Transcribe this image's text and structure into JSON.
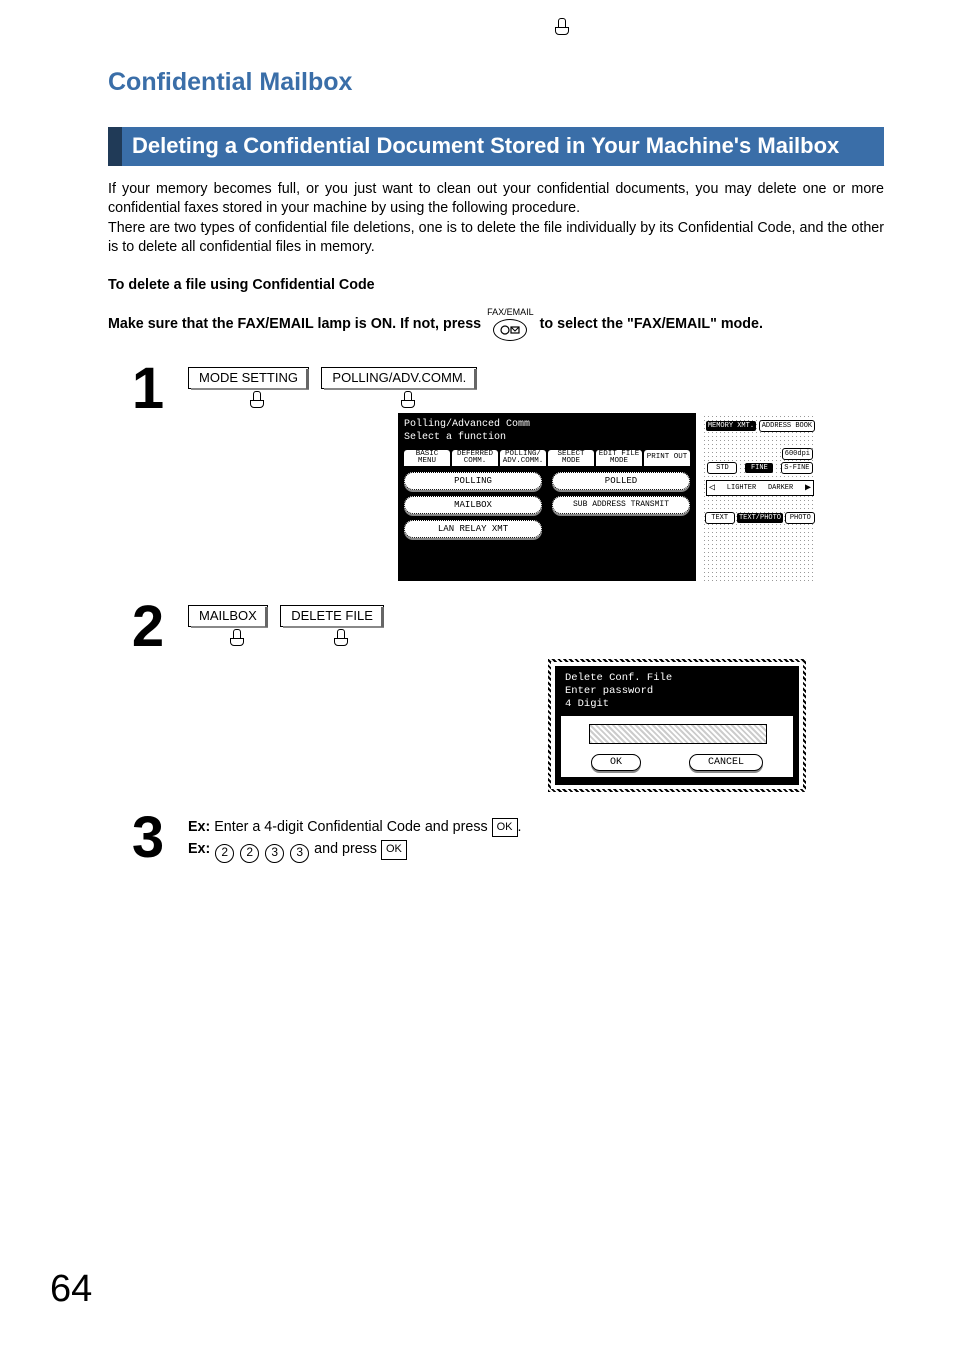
{
  "page_title": "Confidential Mailbox",
  "section_title": "Deleting a Confidential Document Stored in Your Machine's Mailbox",
  "intro": "If your memory becomes full, or you just want to clean out your confidential documents, you may delete one or more confidential faxes stored in your machine by using the following procedure.\nThere are two types of confidential file deletions, one is to delete the file individually by its Confidential Code, and the other is to delete all confidential files in memory.",
  "sub_heading": "To delete a file using Confidential Code",
  "make_sure": {
    "part1": "Make sure that the FAX/EMAIL lamp is ON.  If not, press ",
    "icon_label": "FAX/EMAIL",
    "part2": " to select the \"FAX/EMAIL\" mode."
  },
  "steps": {
    "s1": {
      "num": "1",
      "btn1": "MODE SETTING",
      "btn2": "POLLING/ADV.COMM."
    },
    "s2": {
      "num": "2",
      "btn1": "MAILBOX",
      "btn2": "DELETE FILE"
    },
    "s3": {
      "num": "3",
      "ex_label": "Ex:",
      "line1_text": "Enter a 4-digit Confidential Code and press ",
      "ok": "OK",
      "line2_nums": [
        "2",
        "2",
        "3",
        "3"
      ],
      "line2_mid": " and press "
    }
  },
  "lcd": {
    "header1": "Polling/Advanced Comm",
    "header2": "Select a function",
    "tabs": [
      "BASIC MENU",
      "DEFERRED COMM.",
      "POLLING/ ADV.COMM.",
      "SELECT MODE",
      "EDIT FILE MODE",
      "PRINT OUT"
    ],
    "funcs": [
      "POLLING",
      "POLLED",
      "MAILBOX",
      "SUB ADDRESS TRANSMIT",
      "LAN RELAY XMT"
    ]
  },
  "side_panel": {
    "top_row": [
      "MEMORY XMT.",
      "ADDRESS BOOK"
    ],
    "dpi": "600dpi",
    "row2": [
      "STD",
      "FINE",
      "S-FINE"
    ],
    "lighter": "LIGHTER",
    "darker": "DARKER",
    "row4": [
      "TEXT",
      "TEXT/PHOTO",
      "PHOTO"
    ]
  },
  "dialog": {
    "title": "Delete Conf. File\nEnter password\n4 Digit",
    "ok": "OK",
    "cancel": "CANCEL"
  },
  "page_number": "64"
}
